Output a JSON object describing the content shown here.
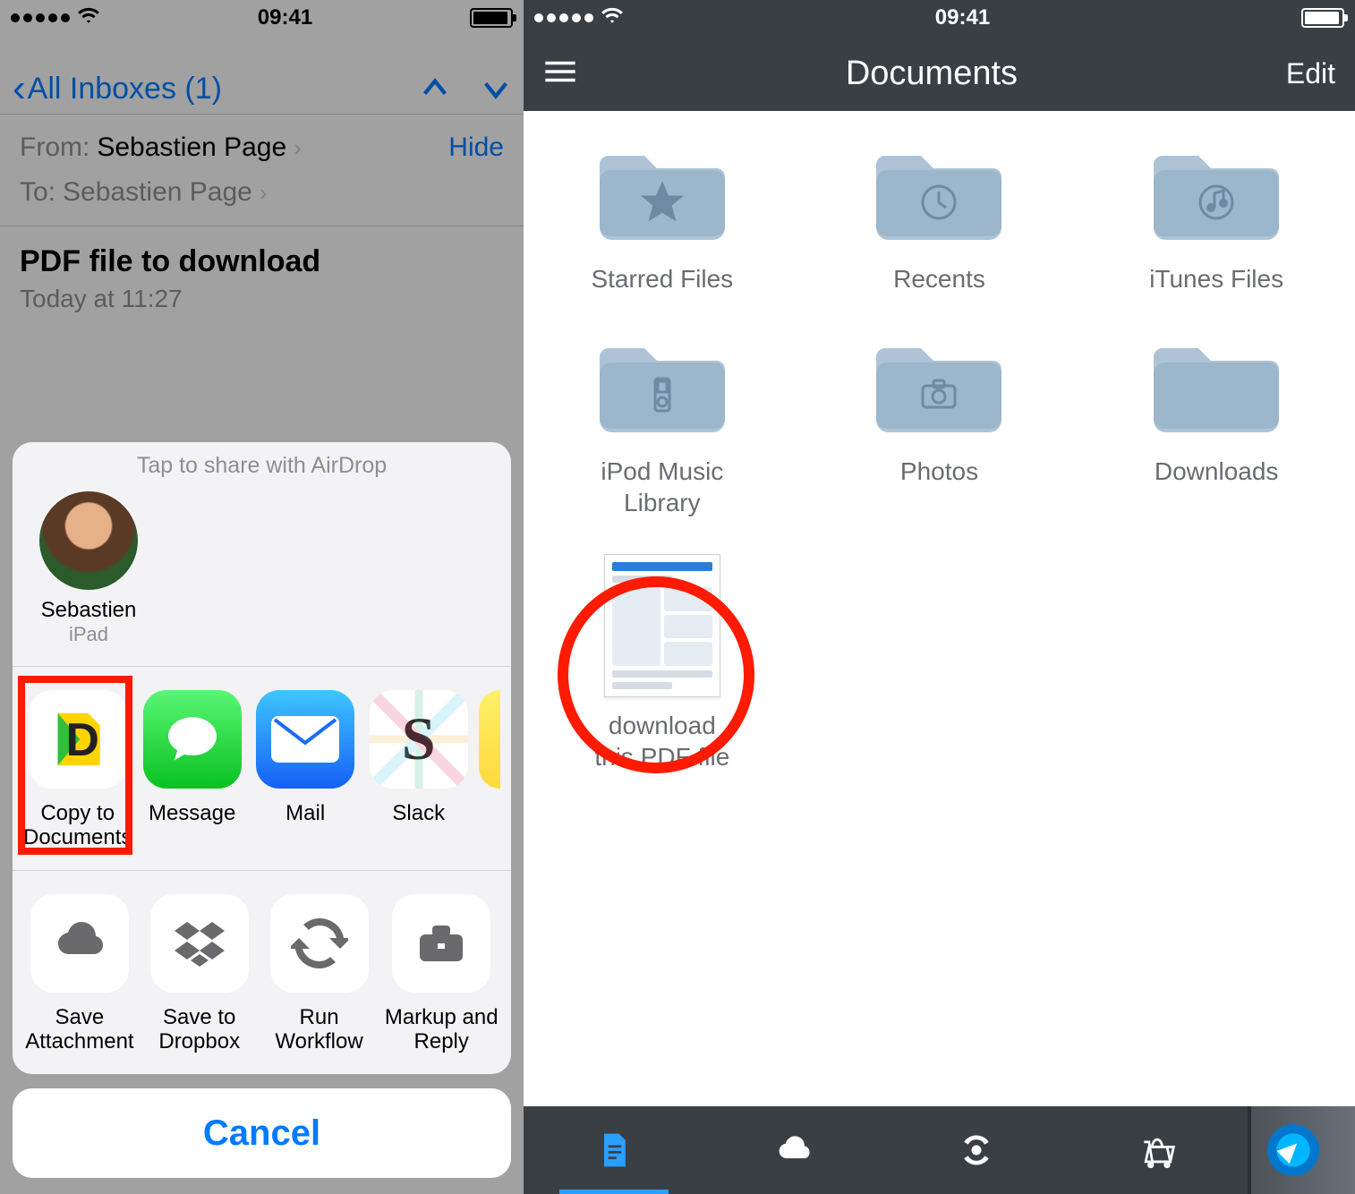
{
  "left": {
    "status": {
      "time": "09:41"
    },
    "mail": {
      "back_label": "All Inboxes (1)",
      "from_label": "From:",
      "from_name": "Sebastien Page",
      "to_label": "To:",
      "to_name": "Sebastien Page",
      "hide_label": "Hide",
      "subject": "PDF file to download",
      "date": "Today at 11:27"
    },
    "share": {
      "airdrop_title": "Tap to share with AirDrop",
      "airdrop": {
        "name": "Sebastien",
        "device": "iPad"
      },
      "apps": [
        {
          "label": "Copy to\nDocuments",
          "icon": "documents"
        },
        {
          "label": "Message",
          "icon": "messages"
        },
        {
          "label": "Mail",
          "icon": "mail"
        },
        {
          "label": "Slack",
          "icon": "slack"
        }
      ],
      "actions": [
        {
          "label": "Save\nAttachment"
        },
        {
          "label": "Save to\nDropbox"
        },
        {
          "label": "Run\nWorkflow"
        },
        {
          "label": "Markup and\nReply"
        }
      ],
      "cancel": "Cancel"
    }
  },
  "right": {
    "status": {
      "time": "09:41"
    },
    "nav": {
      "title": "Documents",
      "edit": "Edit"
    },
    "folders": [
      {
        "label": "Starred Files",
        "icon": "star"
      },
      {
        "label": "Recents",
        "icon": "clock"
      },
      {
        "label": "iTunes Files",
        "icon": "music-note"
      },
      {
        "label": "iPod Music\nLibrary",
        "icon": "ipod"
      },
      {
        "label": "Photos",
        "icon": "camera"
      },
      {
        "label": "Downloads",
        "icon": ""
      }
    ],
    "file": {
      "label": "download\nthis PDF file"
    }
  }
}
